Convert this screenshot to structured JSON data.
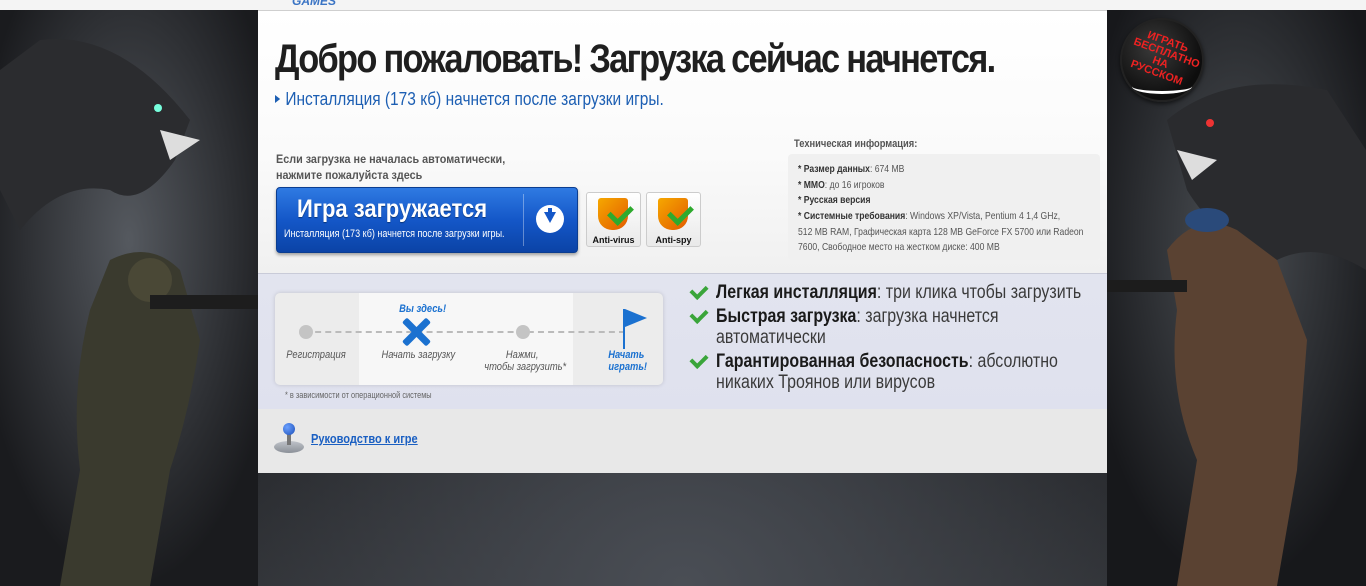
{
  "topbar": {
    "logo_fragment": "GAMES"
  },
  "badge": {
    "text": "ИГРАТЬ БЕСПЛАТНО НА РУССКОМ"
  },
  "hero": {
    "title": "Добро пожаловать! Загрузка сейчас начнется.",
    "subline": "Инсталляция (173 кб) начнется после загрузки игры."
  },
  "download": {
    "note_line1": "Если загрузка не началась автоматически,",
    "note_line2": "нажмите пожалуйста здесь",
    "button_label": "Игра загружается",
    "button_sub": "Инсталляция (173 кб) начнется после загрузки игры."
  },
  "shields": [
    {
      "label": "Anti-virus"
    },
    {
      "label": "Anti-spy"
    }
  ],
  "tech": {
    "title": "Техническая информация:",
    "rows": [
      {
        "key": "* Размер данных",
        "value": ": 674 MB"
      },
      {
        "key": "* MMO",
        "value": ": до 16 игроков"
      },
      {
        "key": "* Русская версия",
        "value": ""
      },
      {
        "key": "* Системные требования",
        "value": ": Windows XP/Vista, Pentium 4 1,4 GHz,"
      },
      {
        "key": "",
        "value": "512 MB RAM, Графическая карта 128 MB GeForce FX 5700 или Radeon"
      },
      {
        "key": "",
        "value": "7600,  Свободное место на жестком диске: 400 MB"
      }
    ]
  },
  "steps": {
    "you_are_here": "Вы здесь!",
    "labels": [
      "Регистрация",
      "Начать загрузку",
      "Нажми,",
      "чтобы загрузить*",
      "Начать",
      "играть!"
    ],
    "footnote": "* в зависимости от операционной системы"
  },
  "features": [
    {
      "bold": "Легкая инсталляция",
      "rest": ": три клика чтобы загрузить"
    },
    {
      "bold": "Быстрая загрузка",
      "rest": ": загрузка начнется автоматически"
    },
    {
      "bold": "Гарантированная безопасность",
      "rest": ": абсолютно никаких Троянов или вирусов"
    }
  ],
  "guide": {
    "link": "Руководство к игре"
  }
}
